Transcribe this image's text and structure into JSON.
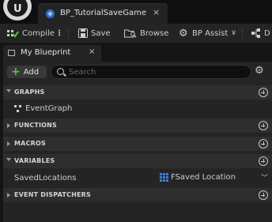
{
  "window": {
    "logo_letter": "U",
    "tab_title": "BP_TutorialSaveGame",
    "tab_close": "×"
  },
  "toolbar": {
    "compile_label": "Compile",
    "more_label": "⋮",
    "save_label": "Save",
    "browse_label": "Browse",
    "bp_assist_label": "BP Assist",
    "bp_assist_caret": "∨",
    "diff_label": "D"
  },
  "panel": {
    "tab_label": "My Blueprint",
    "tab_close": "×",
    "add_label": "Add",
    "add_plus": "+",
    "search_placeholder": "Search",
    "settings_glyph": "⚙"
  },
  "sections": {
    "graphs": "GRAPHS",
    "functions": "FUNCTIONS",
    "macros": "MACROS",
    "variables": "VARIABLES",
    "dispatchers": "EVENT DISPATCHERS"
  },
  "graphs": {
    "items": [
      "EventGraph"
    ]
  },
  "variables": {
    "items": [
      {
        "name": "SavedLocations",
        "type": "FSaved Location",
        "type_color": "#3f7be8",
        "expand": "﹀"
      }
    ]
  },
  "colors": {
    "background": "#151515",
    "panel": "#242424",
    "section_header": "#2e2e2e",
    "compile_accent": "#5ec24a",
    "add_accent": "#5ec24a",
    "tab_icon": "#2f6fd0"
  }
}
